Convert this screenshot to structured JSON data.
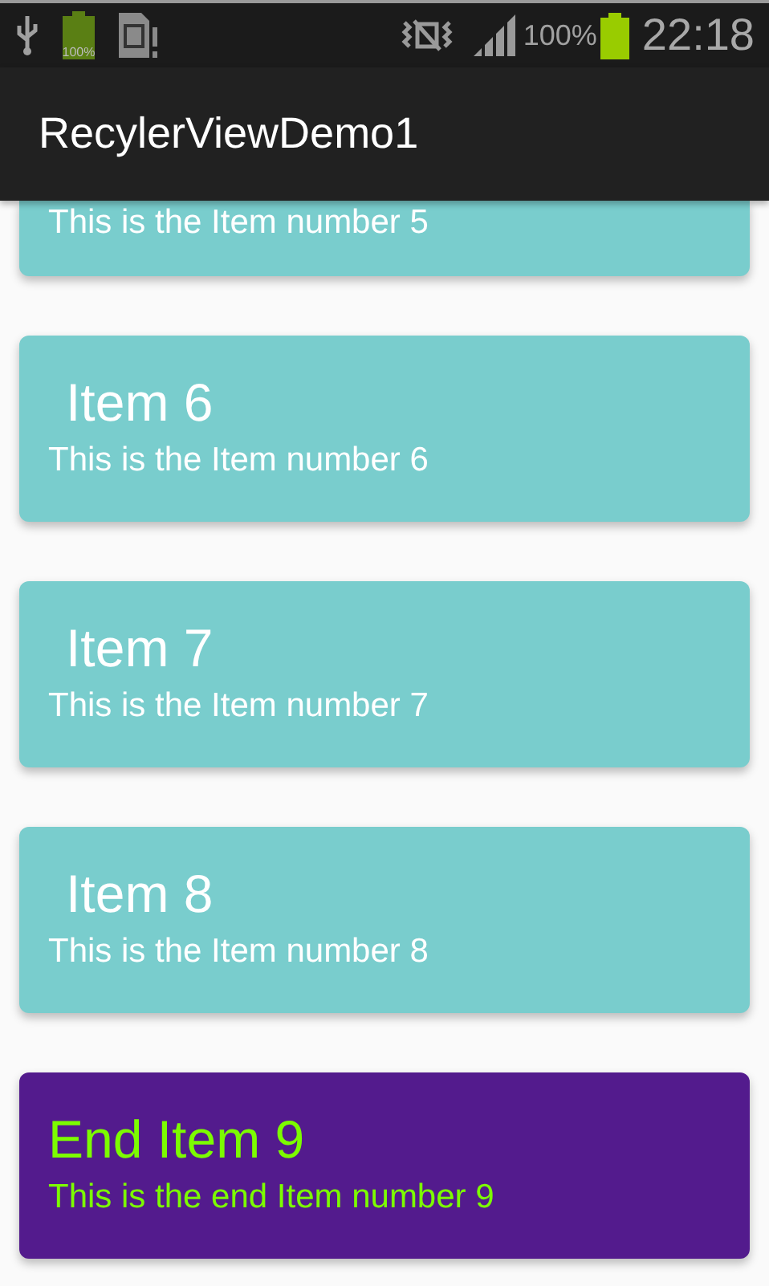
{
  "status_bar": {
    "battery_icon_text": "100%",
    "battery_percent": "100%",
    "time": "22:18"
  },
  "app_bar": {
    "title": "RecylerViewDemo1"
  },
  "items": [
    {
      "kind": "partial",
      "subtitle": "This is the Item number 5"
    },
    {
      "kind": "normal",
      "title": "Item 6",
      "subtitle": "This is the Item number 6"
    },
    {
      "kind": "normal",
      "title": "Item 7",
      "subtitle": "This is the Item number 7"
    },
    {
      "kind": "normal",
      "title": "Item 8",
      "subtitle": "This is the Item number 8"
    },
    {
      "kind": "end",
      "title": "End Item 9",
      "subtitle": "This is the end Item number 9"
    }
  ]
}
